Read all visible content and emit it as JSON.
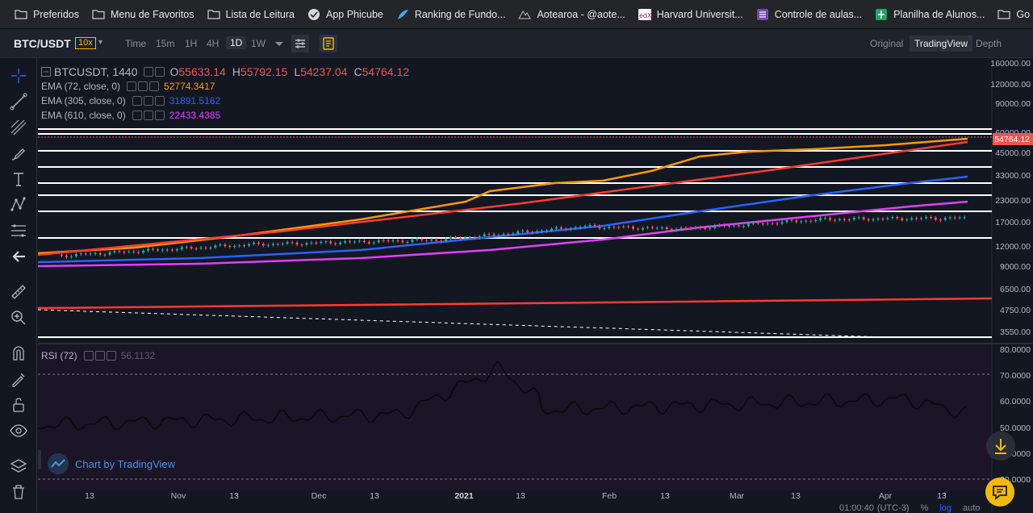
{
  "bookmarks": [
    {
      "label": "Preferidos",
      "icon": "folder-icon"
    },
    {
      "label": "Menu de Favoritos",
      "icon": "folder-icon"
    },
    {
      "label": "Lista de Leitura",
      "icon": "folder-icon"
    },
    {
      "label": "App Phicube",
      "icon": "globe-icon"
    },
    {
      "label": "Ranking de Fundo...",
      "icon": "fund-ranking-icon"
    },
    {
      "label": "Aotearoa - @aote...",
      "icon": "aotearoa-icon"
    },
    {
      "label": "Harvard Universit...",
      "icon": "edx-icon"
    },
    {
      "label": "Controle de aulas...",
      "icon": "forms-icon"
    },
    {
      "label": "Planilha de Alunos...",
      "icon": "sheets-icon"
    },
    {
      "label": "Go English",
      "icon": "folder-icon"
    }
  ],
  "header": {
    "pair": "BTC/USDT",
    "leverage": "10x",
    "timeframes": [
      "Time",
      "15m",
      "1H",
      "4H",
      "1D",
      "1W"
    ],
    "active_timeframe": "1D",
    "views": [
      "Original",
      "TradingView",
      "Depth"
    ],
    "active_view": "TradingView"
  },
  "legend": {
    "symbol": "BTCUSDT, 1440",
    "open_label": "O",
    "open": "55633.14",
    "high_label": "H",
    "high": "55792.15",
    "low_label": "L",
    "low": "54237.04",
    "close_label": "C",
    "close": "54764.12",
    "ema": [
      {
        "label": "EMA (72, close, 0)",
        "value": "52774.3417",
        "color": "#ff9800"
      },
      {
        "label": "EMA (305, close, 0)",
        "value": "31891.5162",
        "color": "#2962ff"
      },
      {
        "label": "EMA (610, close, 0)",
        "value": "22433.4385",
        "color": "#e040fb"
      }
    ]
  },
  "rsi": {
    "label": "RSI (72)",
    "value": "56.1132"
  },
  "price_axis": [
    "160000.00",
    "120000.00",
    "90000.00",
    "60000.00",
    "45000.00",
    "33000.00",
    "23000.00",
    "17000.00",
    "12000.00",
    "9000.00",
    "6500.00",
    "4750.00",
    "3550.00"
  ],
  "current_price": "54764.12",
  "rsi_axis": [
    "80.0000",
    "70.0000",
    "60.0000",
    "50.0000",
    "40.0000",
    "30.0000"
  ],
  "time_axis": [
    "13",
    "Nov",
    "13",
    "Dec",
    "13",
    "2021",
    "13",
    "Feb",
    "13",
    "Mar",
    "13",
    "Apr",
    "13"
  ],
  "watermark": "Chart by TradingView",
  "status": {
    "time": "01:00:40",
    "tz": "(UTC-3)",
    "percent": "%",
    "log": "log",
    "auto": "auto"
  },
  "colors": {
    "up": "#26a69a",
    "down": "#ef5350",
    "ema72": "#ff9800",
    "ema305": "#2962ff",
    "ema610": "#e040fb",
    "accent": "#f0b90b"
  }
}
